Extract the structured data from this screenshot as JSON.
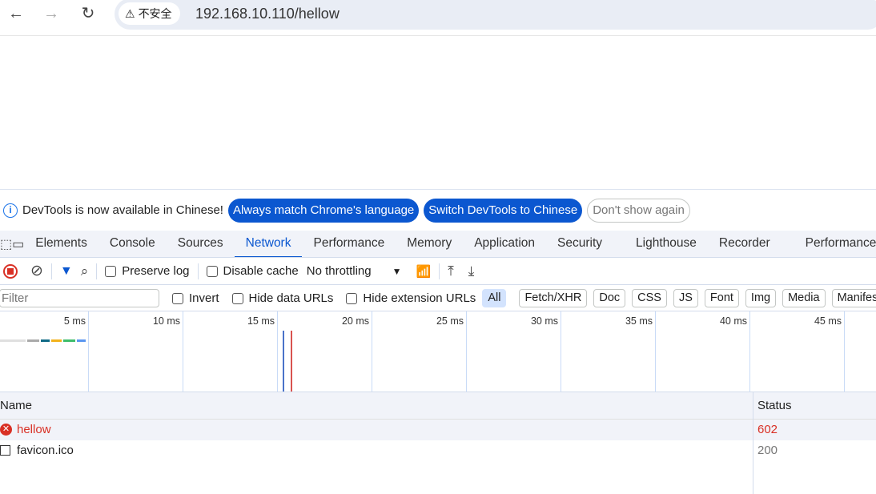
{
  "browser": {
    "security_label": "不安全",
    "url": "192.168.10.110/hellow"
  },
  "infobar": {
    "message": "DevTools is now available in Chinese!",
    "btn_match": "Always match Chrome's language",
    "btn_switch": "Switch DevTools to Chinese",
    "btn_dismiss": "Don't show again"
  },
  "tabs": [
    "Elements",
    "Console",
    "Sources",
    "Network",
    "Performance",
    "Memory",
    "Application",
    "Security",
    "Lighthouse",
    "Recorder",
    "Performance insights"
  ],
  "toolbar": {
    "preserve_log": "Preserve log",
    "disable_cache": "Disable cache",
    "throttling": "No throttling"
  },
  "filterbar": {
    "placeholder": "Filter",
    "invert": "Invert",
    "hide_data": "Hide data URLs",
    "hide_ext": "Hide extension URLs",
    "types": [
      "All",
      "Fetch/XHR",
      "Doc",
      "CSS",
      "JS",
      "Font",
      "Img",
      "Media",
      "Manifest"
    ]
  },
  "timeline": {
    "ticks": [
      "5 ms",
      "10 ms",
      "15 ms",
      "20 ms",
      "25 ms",
      "30 ms",
      "35 ms",
      "40 ms",
      "45 ms"
    ],
    "dom_content_loaded_ms": 15.3,
    "load_ms": 15.7
  },
  "table": {
    "headers": {
      "name": "Name",
      "status": "Status"
    },
    "rows": [
      {
        "name": "hellow",
        "status": "602",
        "error": true
      },
      {
        "name": "favicon.ico",
        "status": "200",
        "error": false
      }
    ]
  },
  "colors": {
    "accent": "#0b57d0",
    "error": "#d93025"
  }
}
